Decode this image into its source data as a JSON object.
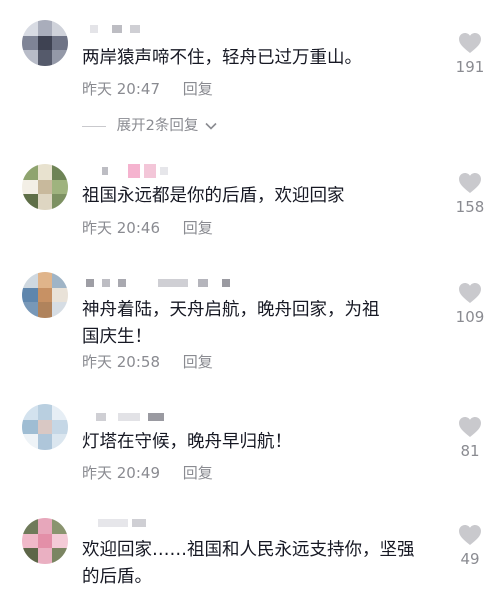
{
  "comments": [
    {
      "text": "两岸猿声啼不住，轻舟已过万重山。",
      "time": "昨天 20:47",
      "reply_label": "回复",
      "likes": "191",
      "expand_label": "展开2条回复"
    },
    {
      "text": "祖国永远都是你的后盾，欢迎回家",
      "time": "昨天 20:46",
      "reply_label": "回复",
      "likes": "158"
    },
    {
      "text": "神舟着陆，天舟启航，晚舟回家，为祖国庆生！",
      "time": "昨天 20:58",
      "reply_label": "回复",
      "likes": "109"
    },
    {
      "text": "灯塔在守候，晚舟早归航！",
      "time": "昨天 20:49",
      "reply_label": "回复",
      "likes": "81"
    },
    {
      "text": "欢迎回家……祖国和人民永远支持你，坚强的后盾。",
      "time": "",
      "reply_label": "",
      "likes": "49"
    }
  ],
  "icons": {
    "like": "heart-icon",
    "expand": "chevron-down-icon"
  },
  "colors": {
    "text": "#161823",
    "secondary": "#8a8b91",
    "heart": "#c9c9cd"
  }
}
